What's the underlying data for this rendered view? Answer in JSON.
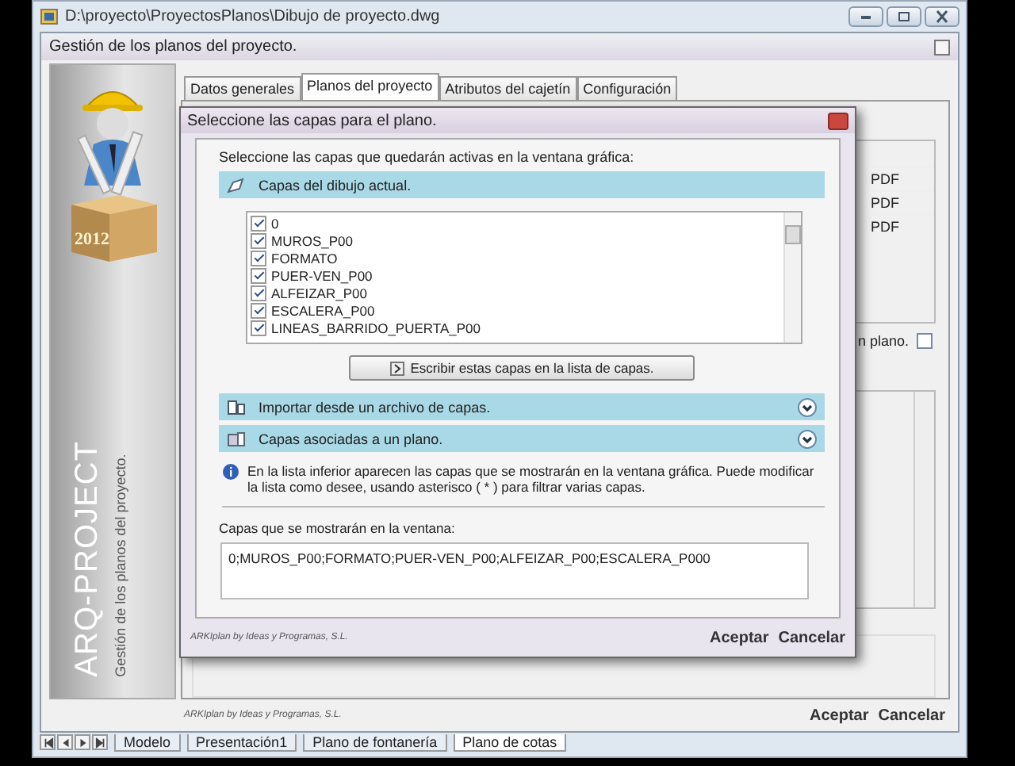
{
  "window": {
    "title": "D:\\proyecto\\ProyectosPlanos\\Dibujo de proyecto.dwg"
  },
  "main_dialog": {
    "title": "Gestión de los planos del proyecto.",
    "sidebar": {
      "box_label": "2012",
      "brand": "ARQ-PROJECT",
      "subtitle": "Gestión de los planos del proyecto."
    },
    "tabs": [
      {
        "label": "Datos generales",
        "selected": false
      },
      {
        "label": "Planos del proyecto",
        "selected": true
      },
      {
        "label": "Atributos del cajetín",
        "selected": false
      },
      {
        "label": "Configuración",
        "selected": false
      }
    ],
    "table_column_values": [
      "PDF",
      "PDF",
      "PDF"
    ],
    "option": {
      "label": "n plano.",
      "checked": false
    },
    "footer": "ARKIplan by Ideas y Programas, S.L.",
    "buttons": [
      "Aceptar",
      "Cancelar"
    ]
  },
  "layer_dialog": {
    "title": "Seleccione las capas para el plano.",
    "instruction": "Seleccione las capas que quedarán activas en la ventana gráfica:",
    "sections": [
      {
        "label": "Capas del dibujo actual.",
        "expanded": true
      },
      {
        "label": "Importar desde un archivo de capas.",
        "expanded": false
      },
      {
        "label": "Capas asociadas a un plano.",
        "expanded": false
      }
    ],
    "layers": [
      {
        "name": "0",
        "checked": true
      },
      {
        "name": "MUROS_P00",
        "checked": true
      },
      {
        "name": "FORMATO",
        "checked": true
      },
      {
        "name": "PUER-VEN_P00",
        "checked": true
      },
      {
        "name": "ALFEIZAR_P00",
        "checked": true
      },
      {
        "name": "ESCALERA_P00",
        "checked": true
      },
      {
        "name": "LINEAS_BARRIDO_PUERTA_P00",
        "checked": true
      }
    ],
    "write_button": "Escribir estas capas en la lista de capas.",
    "info": "En la lista inferior aparecen las capas que se mostrarán en la ventana gráfica. Puede modificar la lista como desee, usando asterisco ( * ) para filtrar varias capas.",
    "field_label": "Capas que se mostrarán en la ventana:",
    "field_value": "0;MUROS_P00;FORMATO;PUER-VEN_P00;ALFEIZAR_P00;ESCALERA_P000",
    "footer": "ARKIplan by Ideas y Programas, S.L.",
    "buttons": [
      "Aceptar",
      "Cancelar"
    ]
  },
  "sheet_tabs": [
    {
      "label": "Modelo",
      "selected": false
    },
    {
      "label": "Presentación1",
      "selected": false
    },
    {
      "label": "Plano de fontanería",
      "selected": false
    },
    {
      "label": "Plano de cotas",
      "selected": true
    }
  ]
}
